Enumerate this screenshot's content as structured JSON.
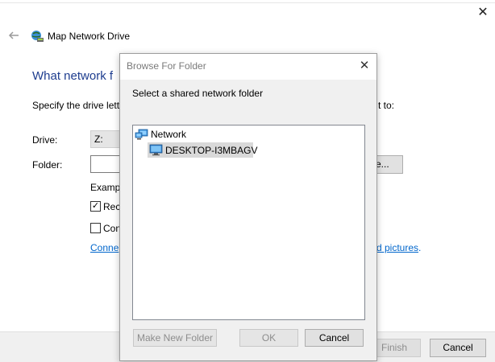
{
  "wizard": {
    "title": "Map Network Drive",
    "heading_fragment": "What network f",
    "description_left_fragment": "Specify the drive lett",
    "description_right_fragment": "t to:",
    "drive_label": "Drive:",
    "drive_value": "Z:",
    "folder_label": "Folder:",
    "folder_value": "",
    "browse_fragment": "e...",
    "example_fragment": "Examp",
    "reconnect_fragment": "Rec",
    "reconnect_checked": true,
    "credentials_fragment": "Con",
    "credentials_checked": false,
    "link_left_fragment": "Conne",
    "link_right_fragment": "d pictures",
    "link_right_suffix": ".",
    "finish_label": "Finish",
    "cancel_label": "Cancel",
    "icons": {
      "back": "back-arrow-icon",
      "wizard": "network-drive-icon",
      "close": "close-icon"
    }
  },
  "dialog": {
    "title": "Browse For Folder",
    "instruction": "Select a shared network folder",
    "tree": {
      "root_label": "Network",
      "root_icon": "network-icon",
      "items": [
        {
          "label": "DESKTOP-I3MBAGV",
          "icon": "computer-icon",
          "selected": true
        }
      ]
    },
    "buttons": {
      "new_folder": "Make New Folder",
      "ok": "OK",
      "cancel": "Cancel"
    }
  },
  "colors": {
    "heading": "#1e3d8f",
    "link": "#0066cc",
    "selection": "#d9d9d9",
    "dialog_body": "#f0f0f0"
  }
}
